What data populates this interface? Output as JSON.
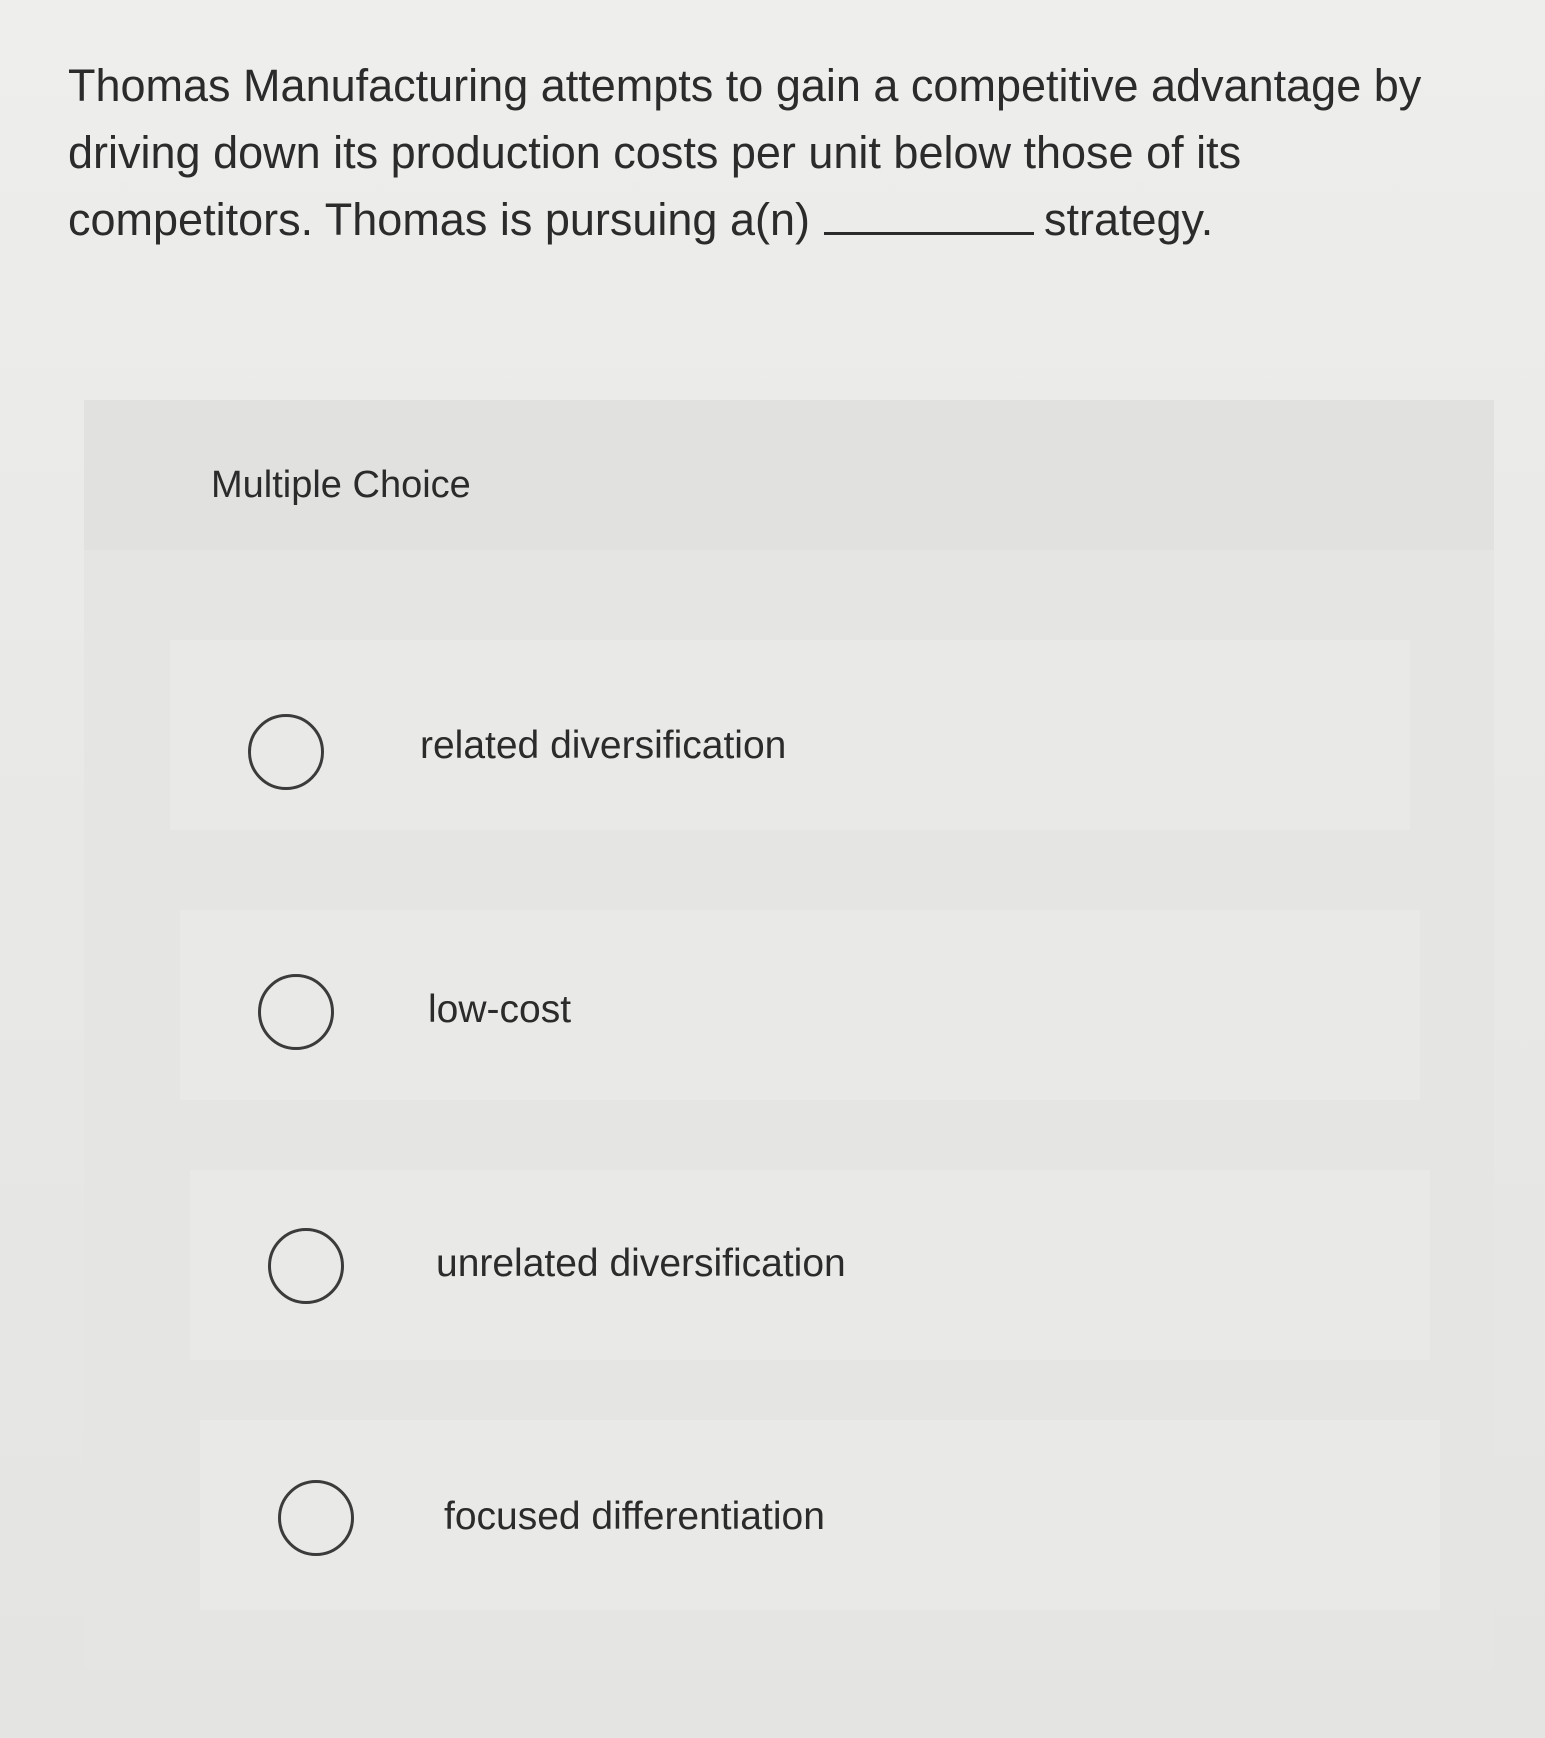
{
  "question": {
    "text_before": "Thomas Manufacturing attempts to gain a competitive advantage by driving down its production costs per unit below those of its competitors. Thomas is pursuing a(n)",
    "text_after": "strategy."
  },
  "multiple_choice": {
    "title": "Multiple Choice",
    "options": [
      {
        "label": "related diversification"
      },
      {
        "label": "low-cost"
      },
      {
        "label": "unrelated diversification"
      },
      {
        "label": "focused differentiation"
      }
    ]
  }
}
